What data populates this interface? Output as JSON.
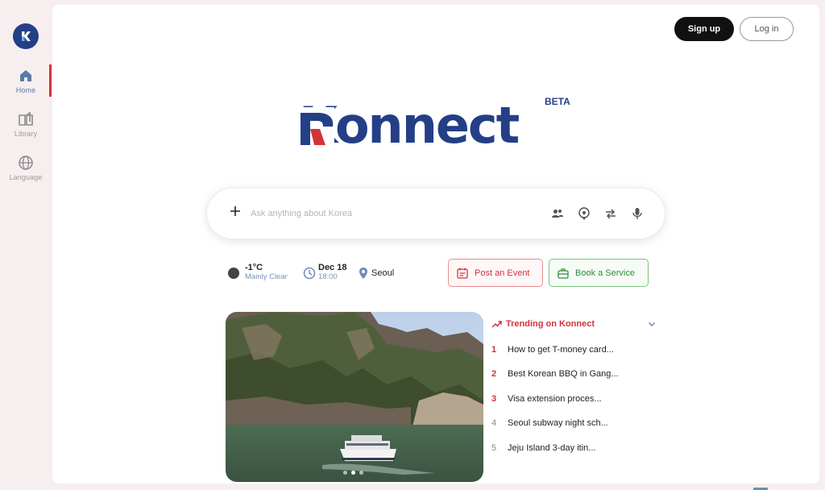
{
  "sidebar": {
    "logo_letter": "K",
    "items": [
      {
        "label": "Home",
        "icon": "home-icon",
        "active": true
      },
      {
        "label": "Library",
        "icon": "book-icon",
        "active": false
      },
      {
        "label": "Language",
        "icon": "globe-icon",
        "active": false
      }
    ]
  },
  "header": {
    "signup_label": "Sign up",
    "login_label": "Log in"
  },
  "brand": {
    "name": "Konnect",
    "badge": "BETA"
  },
  "search": {
    "placeholder": "Ask anything about Korea",
    "value": "",
    "icons": [
      "plus-icon",
      "people-icon",
      "location-pin-icon",
      "swap-icon",
      "microphone-icon"
    ]
  },
  "info": {
    "temperature": "-1°C",
    "condition": "Mainly Clear",
    "date": "Dec 18",
    "time": "18:00",
    "location": "Seoul"
  },
  "actions": {
    "post_event": "Post an Event",
    "book_service": "Book a Service"
  },
  "trending": {
    "title": "Trending on Konnect",
    "items": [
      {
        "rank": "1",
        "text": "How to get T-money card..."
      },
      {
        "rank": "2",
        "text": "Best Korean BBQ in Gang..."
      },
      {
        "rank": "3",
        "text": "Visa extension proces..."
      },
      {
        "rank": "4",
        "text": "Seoul subway night sch..."
      },
      {
        "rank": "5",
        "text": "Jeju Island 3-day itin..."
      }
    ]
  },
  "carousel": {
    "slide_count": 3,
    "active_slide": 2
  },
  "colors": {
    "brand_blue": "#243f86",
    "accent_red": "#d2333b",
    "accent_green": "#2f8f3a"
  }
}
